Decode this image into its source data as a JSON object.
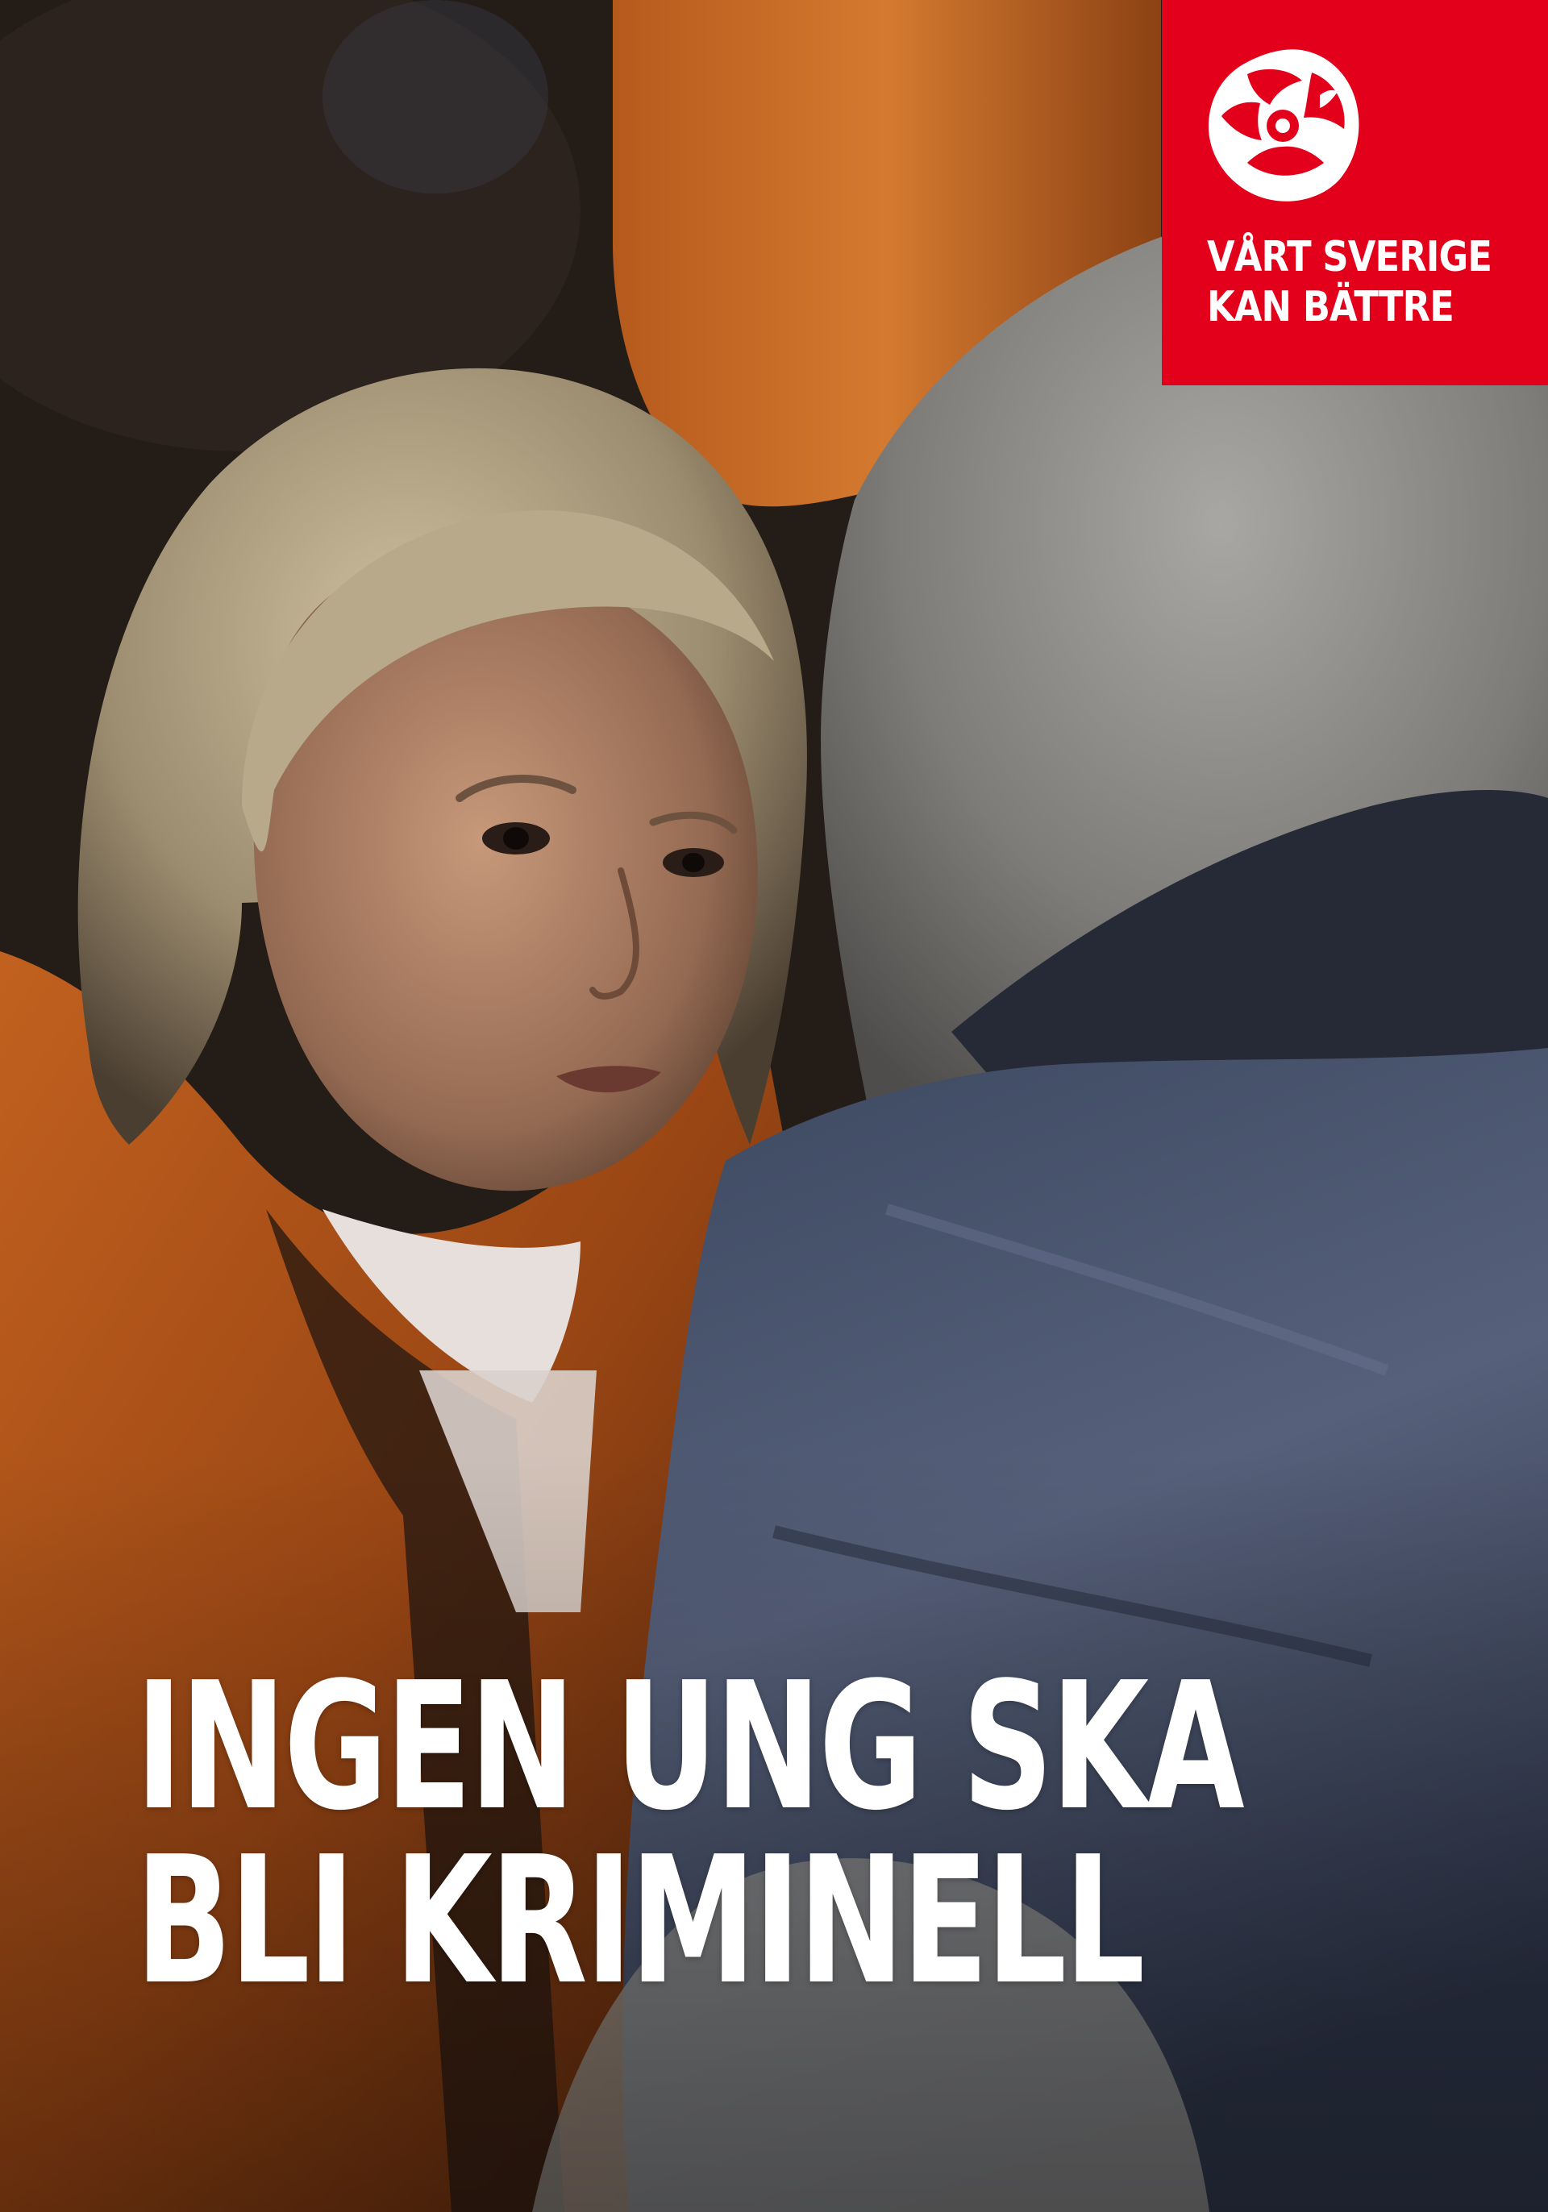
{
  "poster": {
    "brand_color": "#e3001b",
    "headline": {
      "line1": "INGEN UNG SKA",
      "line2": "BLI KRIMINELL"
    },
    "badge": {
      "logo_icon": "rose-icon",
      "slogan_line1": "VÅRT SVERIGE",
      "slogan_line2": "KAN BÄTTRE"
    }
  }
}
